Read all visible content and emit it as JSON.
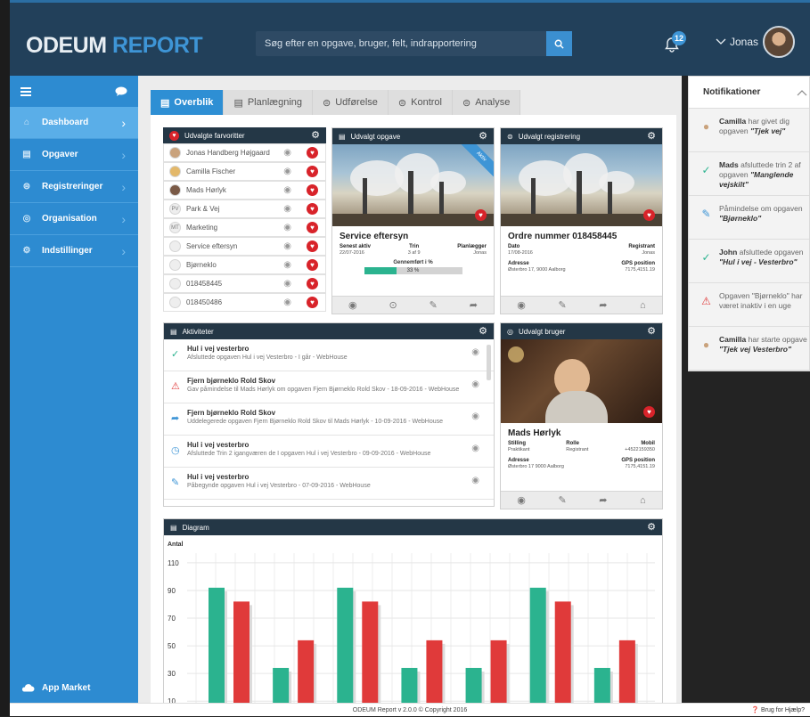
{
  "app": {
    "logo_part1": "ODEUM",
    "logo_part2": "REPORT"
  },
  "header": {
    "search_placeholder": "Søg efter en opgave, bruger, felt, indrapportering",
    "notification_count": "12",
    "user_name": "Jonas"
  },
  "sidebar": {
    "items": [
      {
        "label": "Dashboard",
        "icon": "home-icon"
      },
      {
        "label": "Opgaver",
        "icon": "document-icon"
      },
      {
        "label": "Registreringer",
        "icon": "list-icon"
      },
      {
        "label": "Organisation",
        "icon": "org-icon"
      },
      {
        "label": "Indstillinger",
        "icon": "gear-icon"
      }
    ],
    "app_market": "App Market"
  },
  "tabs": [
    {
      "label": "Overblik"
    },
    {
      "label": "Planlægning"
    },
    {
      "label": "Udførelse"
    },
    {
      "label": "Kontrol"
    },
    {
      "label": "Analyse"
    }
  ],
  "favorites": {
    "title": "Udvalgte farvoritter",
    "items": [
      {
        "label": "Jonas Handberg Højgaard",
        "avatar": ""
      },
      {
        "label": "Camilla Fischer",
        "avatar": ""
      },
      {
        "label": "Mads Hørlyk",
        "avatar": ""
      },
      {
        "label": "Park & Vej",
        "avatar": "PV"
      },
      {
        "label": "Marketing",
        "avatar": "MT"
      },
      {
        "label": "Service eftersyn",
        "avatar": ""
      },
      {
        "label": "Bjørneklo",
        "avatar": ""
      },
      {
        "label": "018458445",
        "avatar": ""
      },
      {
        "label": "018450486",
        "avatar": ""
      }
    ]
  },
  "task_card": {
    "title": "Udvalgt opgave",
    "ribbon": "Aktiv",
    "name": "Service eftersyn",
    "col1_label": "Senest aktiv",
    "col1_value": "22/07-2016",
    "col2_label": "Trin",
    "col2_value": "3 af 9",
    "col3_label": "Planlægger",
    "col3_value": "Jonas",
    "progress_label": "Gennemført i %",
    "progress_text": "33 %",
    "progress_value": 0.33
  },
  "registration_card": {
    "title": "Udvalgt registrering",
    "name": "Ordre nummer 018458445",
    "date_label": "Dato",
    "date_value": "17/08-2016",
    "reg_label": "Registrant",
    "reg_value": "Jonas",
    "address_label": "Adresse",
    "address_value": "Østerbro 17, 9000 Aalborg",
    "gps_label": "GPS position",
    "gps_value": "7175,4151.19"
  },
  "activities": {
    "title": "Aktiviteter",
    "items": [
      {
        "title": "Hul i vej vesterbro",
        "desc": "Afsluttede opgaven Hul i vej Vesterbro - I går - WebHouse",
        "icon": "check-circle-icon",
        "color": "#2bb38f"
      },
      {
        "title": "Fjern bjørneklo Rold Skov",
        "desc": "Gav påmindelse til Mads Hørlyk om opgaven Fjern Bjørneklo Rold Skov - 18-09-2016 - WebHouse",
        "icon": "warning-icon",
        "color": "#e03a3a"
      },
      {
        "title": "Fjern bjørneklo Rold Skov",
        "desc": "Uddelegerede opgaven Fjern Bjørneklo Rold Skov til Mads Hørlyk - 10-09-2016 - WebHouse",
        "icon": "share-icon",
        "color": "#3e95d6"
      },
      {
        "title": "Hul i vej vesterbro",
        "desc": "Afsluttede Trin 2 igangværen de I opgaven Hul i vej Vesterbro - 09-09-2016 - WebHouse",
        "icon": "clock-icon",
        "color": "#3e95d6"
      },
      {
        "title": "Hul i vej vesterbro",
        "desc": "Påbegynde opgaven Hul i vej Vesterbro - 07-09-2016 - WebHouse",
        "icon": "pen-icon",
        "color": "#3e95d6"
      }
    ]
  },
  "user_card": {
    "title": "Udvalgt bruger",
    "name": "Mads Hørlyk",
    "role_label": "Stilling",
    "role_value": "Praktikant",
    "rolle_label": "Rolle",
    "rolle_value": "Registrant",
    "mobile_label": "Mobil",
    "mobile_value": "+4522159350",
    "address_label": "Adresse",
    "address_value": "Østerbro 17 9000 Aalborg",
    "gps_label": "GPS position",
    "gps_value": "7175,4151.19"
  },
  "diagram": {
    "title": "Diagram"
  },
  "chart_data": {
    "type": "bar",
    "ylabel": "Antal",
    "yticks": [
      10,
      30,
      50,
      70,
      90,
      110
    ],
    "ylim": [
      5,
      117
    ],
    "grid": true,
    "series": [
      {
        "values": [
          92,
          34,
          92,
          34,
          34,
          92,
          34
        ],
        "color": "#2bb38f"
      },
      {
        "values": [
          82,
          54,
          82,
          54,
          54,
          82,
          54
        ],
        "color": "#e03a3a"
      }
    ]
  },
  "notifications": {
    "title": "Notifikationer",
    "items": [
      {
        "bold": "Camilla",
        "text": " har givet dig opgaven ",
        "em": "\"Tjek vej\"",
        "icon": "avatar-icon"
      },
      {
        "bold": "Mads",
        "text": " afsluttede trin 2 af opgaven ",
        "em": "\"Manglende vejskilt\"",
        "icon": "check-circle-icon"
      },
      {
        "bold": "",
        "text": "Påmindelse om opgaven ",
        "em": "\"Bjørneklo\"",
        "icon": "pen-icon"
      },
      {
        "bold": "John",
        "text": " afsluttede opgaven ",
        "em": "\"Hul i vej - Vesterbro\"",
        "icon": "check-circle-icon"
      },
      {
        "bold": "",
        "text": "Opgaven \"Bjørneklo\" har været inaktiv i en uge",
        "em": "",
        "icon": "warning-icon"
      },
      {
        "bold": "Camilla",
        "text": " har starte opgave ",
        "em": "\"Tjek vej Vesterbro\"",
        "icon": "avatar-icon"
      }
    ]
  },
  "footer": {
    "text": "ODEUM Report v 2.0.0 © Copyright 2016",
    "help": "Brug for Hjælp?"
  }
}
